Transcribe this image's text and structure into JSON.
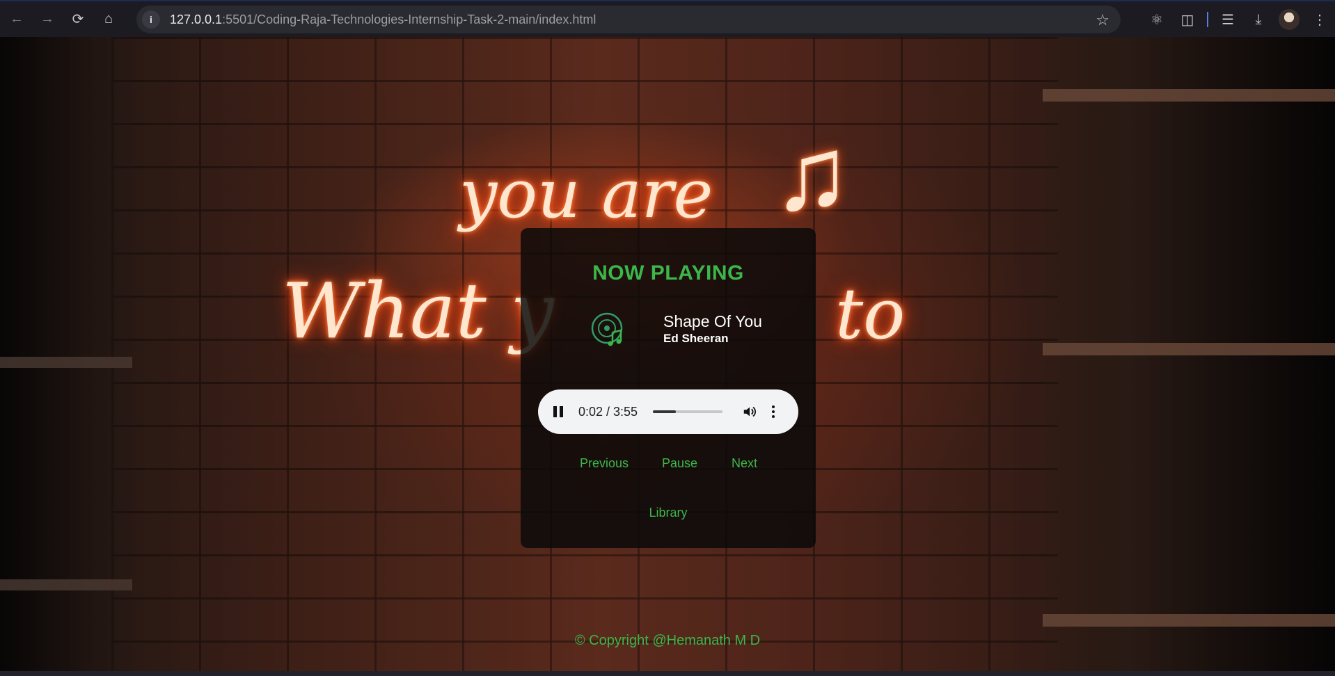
{
  "browser": {
    "url_host": "127.0.0.1",
    "url_rest": ":5501/Coding-Raja-Technologies-Internship-Task-2-main/index.html",
    "icons": [
      "back-icon",
      "forward-icon",
      "reload-icon",
      "home-icon",
      "info-icon",
      "star-icon",
      "react-devtools-icon",
      "extensions-icon",
      "media-icon",
      "download-icon",
      "menu-icon"
    ]
  },
  "background": {
    "neon_top": "you are",
    "neon_bottom": "What y",
    "neon_to": "to",
    "neon_note": "♫",
    "neon_color": "#ff5a1e"
  },
  "player": {
    "heading": "NOW PLAYING",
    "song_title": "Shape Of You",
    "song_artist": "Ed Sheeran",
    "audio": {
      "time": "0:02 / 3:55",
      "progress_fraction": 0.33
    },
    "controls": {
      "previous": "Previous",
      "pause": "Pause",
      "next": "Next",
      "library": "Library"
    },
    "accent_color": "#3cb64a"
  },
  "footer": {
    "copyright": "© Copyright @Hemanath M D"
  }
}
